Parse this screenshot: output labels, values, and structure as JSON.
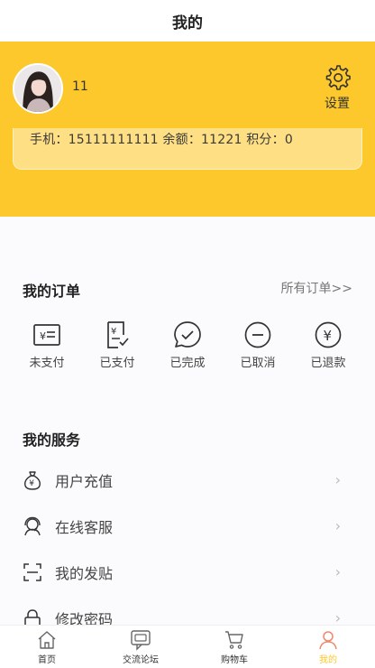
{
  "header": {
    "title": "我的"
  },
  "profile": {
    "username": "11",
    "settings_label": "设置",
    "info_line": "手机：15111111111   余额：11221   积分：0"
  },
  "orders": {
    "title": "我的订单",
    "all_link": "所有订单>>",
    "items": [
      {
        "label": "未支付",
        "icon": "unpaid-icon"
      },
      {
        "label": "已支付",
        "icon": "paid-icon"
      },
      {
        "label": "已完成",
        "icon": "completed-icon"
      },
      {
        "label": "已取消",
        "icon": "cancelled-icon"
      },
      {
        "label": "已退款",
        "icon": "refund-icon"
      }
    ]
  },
  "services": {
    "title": "我的服务",
    "items": [
      {
        "label": "用户充值",
        "icon": "money-bag-icon"
      },
      {
        "label": "在线客服",
        "icon": "customer-service-icon"
      },
      {
        "label": "我的发贴",
        "icon": "scan-icon"
      },
      {
        "label": "修改密码",
        "icon": "lock-icon"
      }
    ],
    "chevron": "›"
  },
  "tabbar": {
    "items": [
      {
        "label": "首页",
        "icon": "home-icon"
      },
      {
        "label": "交流论坛",
        "icon": "forum-icon"
      },
      {
        "label": "购物车",
        "icon": "cart-icon"
      },
      {
        "label": "我的",
        "icon": "user-icon"
      }
    ],
    "active_index": 3
  },
  "colors": {
    "accent": "#fdc82b",
    "background": "#fbfbfd"
  }
}
